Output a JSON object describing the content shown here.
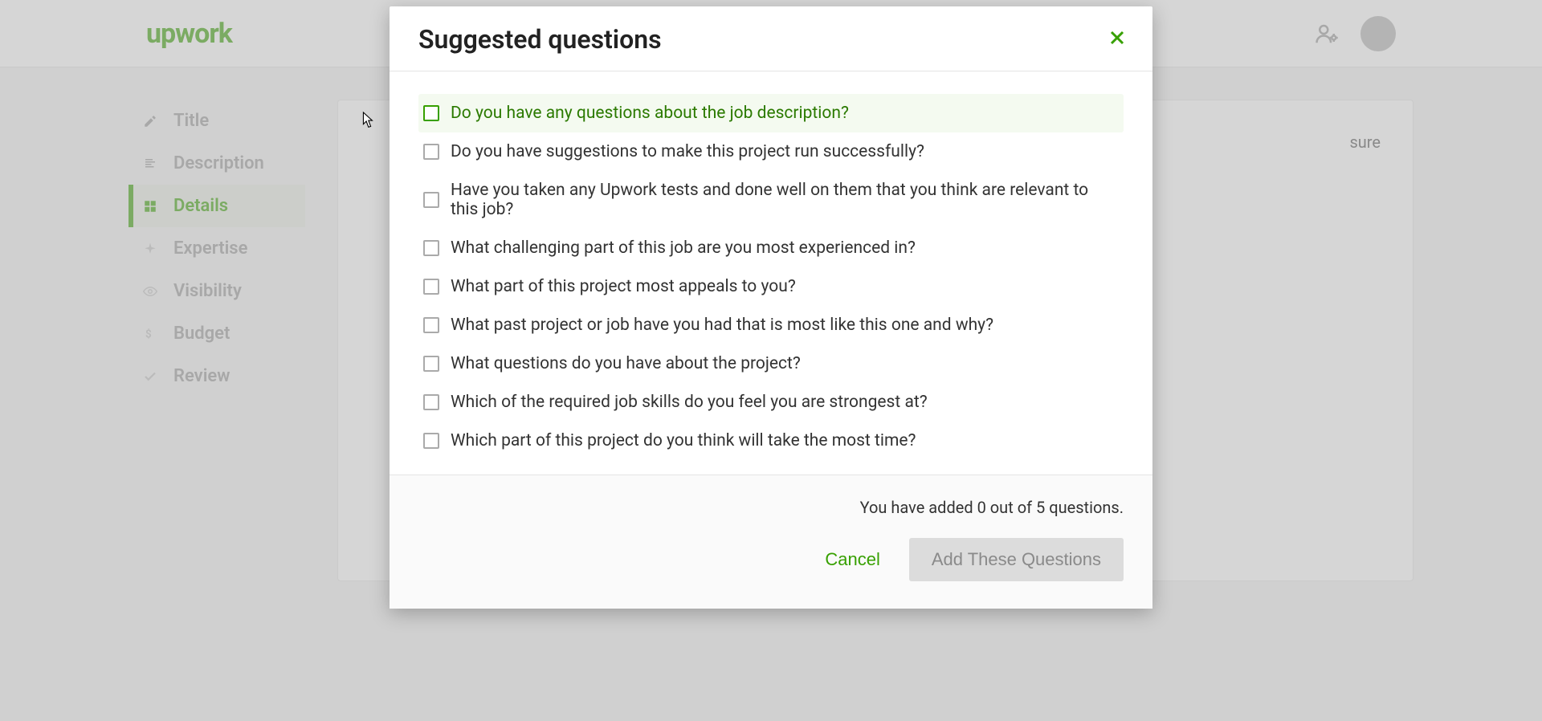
{
  "brand": {
    "logo_text": "upwork"
  },
  "sidebar": {
    "steps": [
      {
        "label": "Title"
      },
      {
        "label": "Description"
      },
      {
        "label": "Details"
      },
      {
        "label": "Expertise"
      },
      {
        "label": "Visibility"
      },
      {
        "label": "Budget"
      },
      {
        "label": "Review"
      }
    ],
    "active_index": 2
  },
  "main_panel": {
    "hint_fragment": "sure"
  },
  "modal": {
    "title": "Suggested questions",
    "questions": [
      "Do you have any questions about the job description?",
      "Do you have suggestions to make this project run successfully?",
      "Have you taken any Upwork tests and done well on them that you think are relevant to this job?",
      "What challenging part of this job are you most experienced in?",
      "What part of this project most appeals to you?",
      "What past project or job have you had that is most like this one and why?",
      "What questions do you have about the project?",
      "Which of the required job skills do you feel you are strongest at?",
      "Which part of this project do you think will take the most time?"
    ],
    "hover_index": 0,
    "count_text": "You have added 0 out of 5 questions.",
    "cancel_label": "Cancel",
    "add_label": "Add These Questions",
    "added": 0,
    "max": 5
  }
}
